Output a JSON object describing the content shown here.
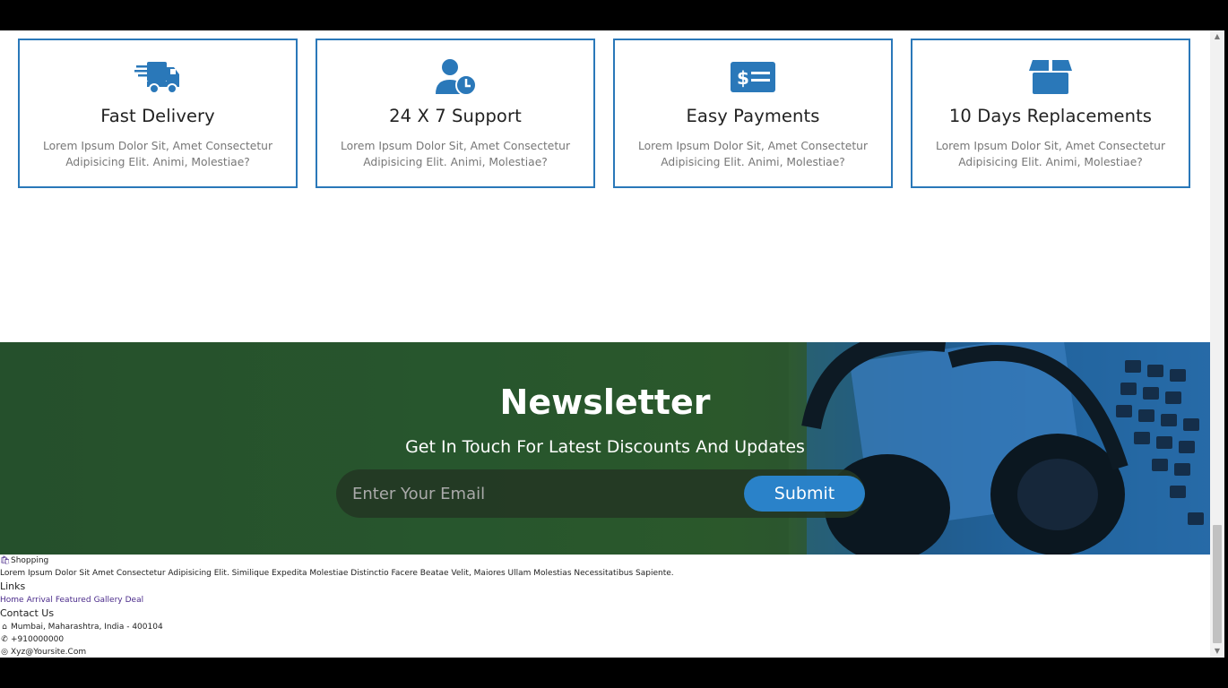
{
  "features": [
    {
      "title": "Fast Delivery",
      "icon": "truck-icon",
      "text": "Lorem Ipsum Dolor Sit, Amet Consectetur Adipisicing Elit. Animi, Molestiae?"
    },
    {
      "title": "24 X 7 Support",
      "icon": "user-clock-icon",
      "text": "Lorem Ipsum Dolor Sit, Amet Consectetur Adipisicing Elit. Animi, Molestiae?"
    },
    {
      "title": "Easy Payments",
      "icon": "money-check-icon",
      "text": "Lorem Ipsum Dolor Sit, Amet Consectetur Adipisicing Elit. Animi, Molestiae?"
    },
    {
      "title": "10 Days Replacements",
      "icon": "box-icon",
      "text": "Lorem Ipsum Dolor Sit, Amet Consectetur Adipisicing Elit. Animi, Molestiae?"
    }
  ],
  "newsletter": {
    "title": "Newsletter",
    "subtitle": "Get In Touch For Latest Discounts And Updates",
    "email_placeholder": "Enter Your Email",
    "submit_label": "Submit"
  },
  "footer": {
    "brand": "Shopping",
    "brand_icon": "shopping-bag-icon",
    "description": "Lorem Ipsum Dolor Sit Amet Consectetur Adipisicing Elit. Similique Expedita Molestiae Distinctio Facere Beatae Velit, Maiores Ullam Molestias Necessitatibus Sapiente.",
    "links_heading": "Links",
    "links": [
      "Home",
      "Arrival",
      "Featured",
      "Gallery",
      "Deal"
    ],
    "contact_heading": "Contact Us",
    "address": "Mumbai, Maharashtra, India - 400104",
    "phone": "+910000000",
    "email": "Xyz@Yoursite.Com"
  },
  "colors": {
    "accent": "#2a78b9",
    "submit": "#2a82c9",
    "link": "#4a2a8a"
  }
}
